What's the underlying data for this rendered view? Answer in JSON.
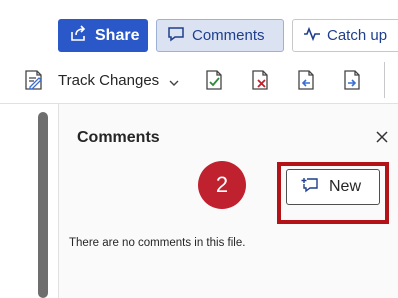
{
  "header": {
    "share_label": "Share",
    "comments_label": "Comments",
    "catchup_label": "Catch up"
  },
  "toolbar": {
    "track_changes_label": "Track Changes"
  },
  "comments_pane": {
    "title": "Comments",
    "new_button_label": "New",
    "empty_message": "There are no comments in this file.",
    "step_badge": "2"
  },
  "colors": {
    "share_bg": "#2b58c8",
    "badge_bg": "#c0212f",
    "highlight_border": "#b31217"
  }
}
